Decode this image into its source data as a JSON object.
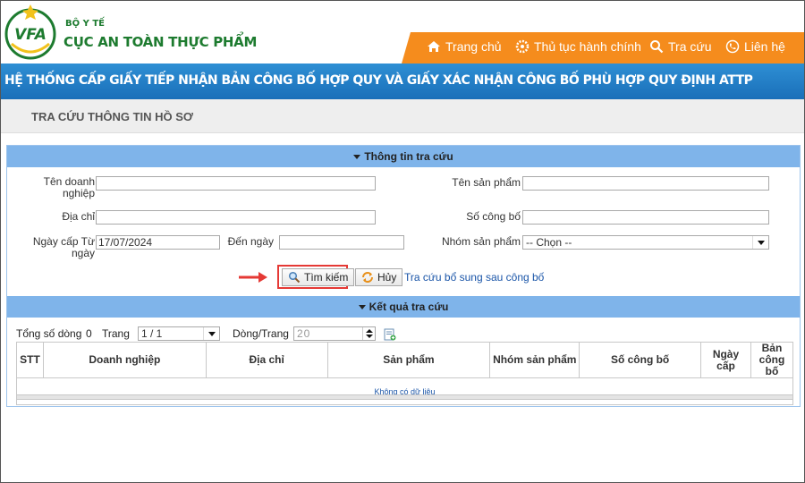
{
  "header": {
    "org_small": "BỘ Y TẾ",
    "org_big": "CỤC AN TOÀN THỰC PHẨM",
    "logo_text": "VFA",
    "nav": [
      {
        "label": "Trang chủ",
        "icon": "home-icon"
      },
      {
        "label": "Thủ tục hành chính",
        "icon": "gears-icon"
      },
      {
        "label": "Tra cứu",
        "icon": "search-icon"
      },
      {
        "label": "Liên hệ",
        "icon": "phone-icon"
      }
    ]
  },
  "banner": {
    "title": "HỆ THỐNG CẤP GIẤY TIẾP NHẬN BẢN CÔNG BỐ HỢP QUY VÀ GIẤY XÁC NHẬN CÔNG BỐ PHÙ HỢP QUY ĐỊNH ATTP"
  },
  "page": {
    "title": "TRA CỨU THÔNG TIN HỒ SƠ"
  },
  "search": {
    "section_title": "Thông tin tra cứu",
    "company_label_1": "Tên doanh",
    "company_label_2": "nghiệp",
    "company_value": "",
    "product_label": "Tên sản phẩm",
    "product_value": "",
    "address_label": "Địa chỉ",
    "address_value": "",
    "number_label": "Số công bố",
    "number_value": "",
    "date_from_label_1": "Ngày cấp Từ",
    "date_from_label_2": "ngày",
    "date_from_value": "17/07/2024",
    "date_to_label": "Đến ngày",
    "date_to_value": "",
    "group_label": "Nhóm sản phẩm",
    "group_value": "-- Chọn --",
    "search_button": "Tìm kiếm",
    "cancel_button": "Hủy",
    "supplement_link": "Tra cứu bổ sung sau công bố"
  },
  "results": {
    "section_title": "Kết quả tra cứu",
    "total_label": "Tổng số dòng",
    "total_value": "0",
    "page_label": "Trang",
    "page_value": "1 / 1",
    "per_page_label": "Dòng/Trang",
    "per_page_value": "20",
    "columns": [
      "STT",
      "Doanh nghiệp",
      "Địa chỉ",
      "Sản phẩm",
      "Nhóm sản phẩm",
      "Số công bố",
      "Ngày cấp",
      "Bản công bố"
    ],
    "empty_message": "Không có dữ liệu"
  },
  "colors": {
    "brand_green": "#1d7b2f",
    "nav_orange": "#f58c1d",
    "banner_blue": "#1a6fb9",
    "section_blue": "#7fb4ea",
    "highlight_red": "#e53935"
  }
}
